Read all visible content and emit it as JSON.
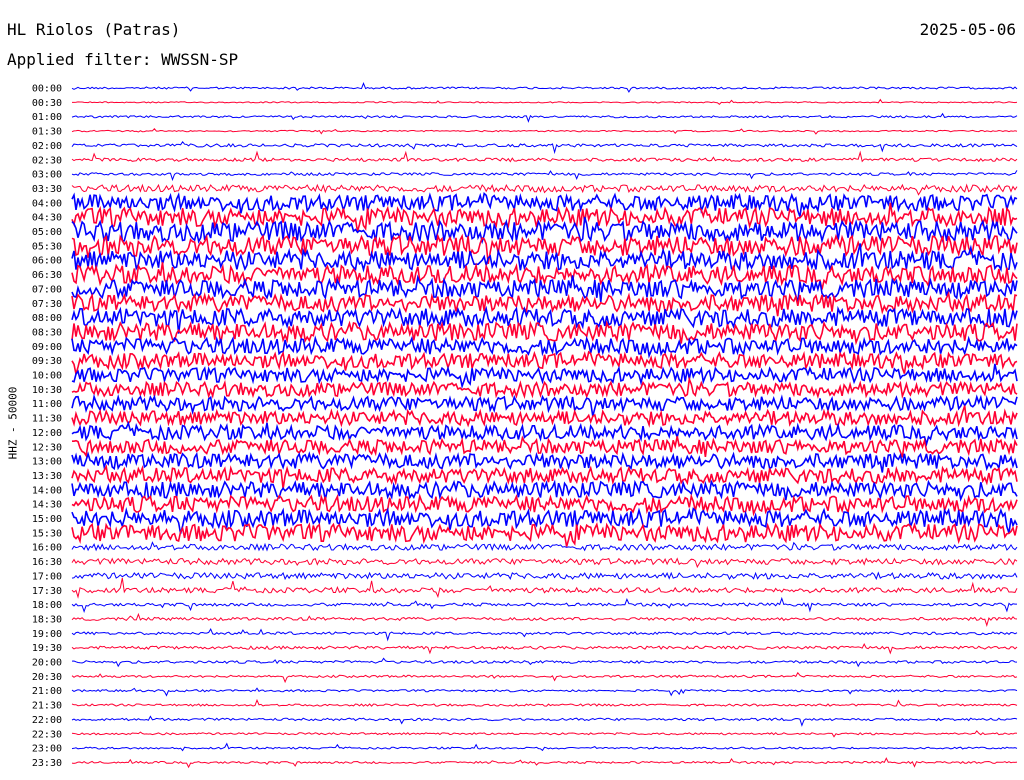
{
  "header": {
    "station": "HL Riolos (Patras)",
    "date": "2025-05-06",
    "filter": "Applied filter: WWSSN-SP"
  },
  "chart_data": {
    "type": "line",
    "ylabel": "HHZ - 50000",
    "row_labels": [
      "00:00",
      "00:30",
      "01:00",
      "01:30",
      "02:00",
      "02:30",
      "03:00",
      "03:30",
      "04:00",
      "04:30",
      "05:00",
      "05:30",
      "06:00",
      "06:30",
      "07:00",
      "07:30",
      "08:00",
      "08:30",
      "09:00",
      "09:30",
      "10:00",
      "10:30",
      "11:00",
      "11:30",
      "12:00",
      "12:30",
      "13:00",
      "13:30",
      "14:00",
      "14:30",
      "15:00",
      "15:30",
      "16:00",
      "16:30",
      "17:00",
      "17:30",
      "18:00",
      "18:30",
      "19:00",
      "19:30",
      "20:00",
      "20:30",
      "21:00",
      "21:30",
      "22:00",
      "22:30",
      "23:00",
      "23:30"
    ],
    "series_colors": [
      "#0000ff",
      "#ff0033"
    ],
    "noise_level": [
      1,
      0.6,
      1,
      0.7,
      1.5,
      1.6,
      1.3,
      3.5,
      8,
      9,
      10,
      10,
      9.5,
      9,
      9,
      8.5,
      9,
      9,
      8,
      7.5,
      7,
      7,
      7,
      7,
      7,
      7,
      7.5,
      7.5,
      8,
      8,
      8.5,
      8.5,
      3,
      3,
      3,
      2.5,
      1.5,
      1.5,
      1.3,
      1.5,
      1.3,
      1.1,
      1,
      1.1,
      1.2,
      1,
      0.9,
      1
    ]
  }
}
